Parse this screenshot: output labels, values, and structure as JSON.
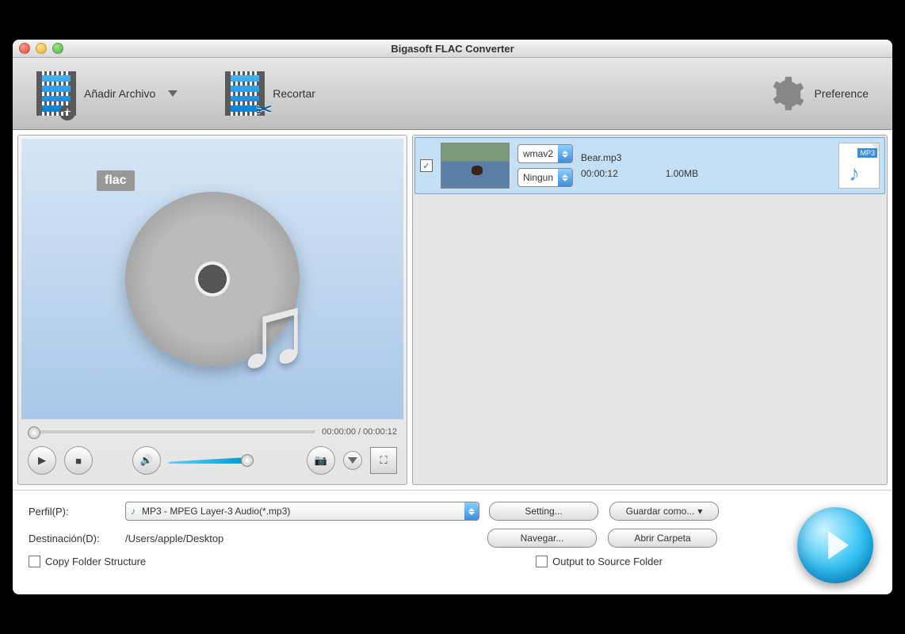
{
  "window": {
    "title": "Bigasoft FLAC Converter"
  },
  "toolbar": {
    "add_file": "Añadir Archivo",
    "trim": "Recortar",
    "preference": "Preference"
  },
  "preview": {
    "badge": "flac",
    "time_current": "00:00:00",
    "time_total": "00:00:12"
  },
  "file": {
    "codec_options": {
      "selected": "wmav2"
    },
    "subtitle_options": {
      "selected": "Ningun"
    },
    "name": "Bear.mp3",
    "duration": "00:00:12",
    "size": "1.00MB",
    "format_badge": "MP3"
  },
  "profile": {
    "label": "Perfil(P):",
    "value": "MP3 - MPEG Layer-3 Audio(*.mp3)"
  },
  "destination": {
    "label": "Destinación(D):",
    "path": "/Users/apple/Desktop"
  },
  "buttons": {
    "setting": "Setting...",
    "save_as": "Guardar como...",
    "browse": "Navegar...",
    "open_folder": "Abrir Carpeta"
  },
  "checkboxes": {
    "copy_structure": "Copy Folder Structure",
    "output_source": "Output to Source Folder"
  }
}
